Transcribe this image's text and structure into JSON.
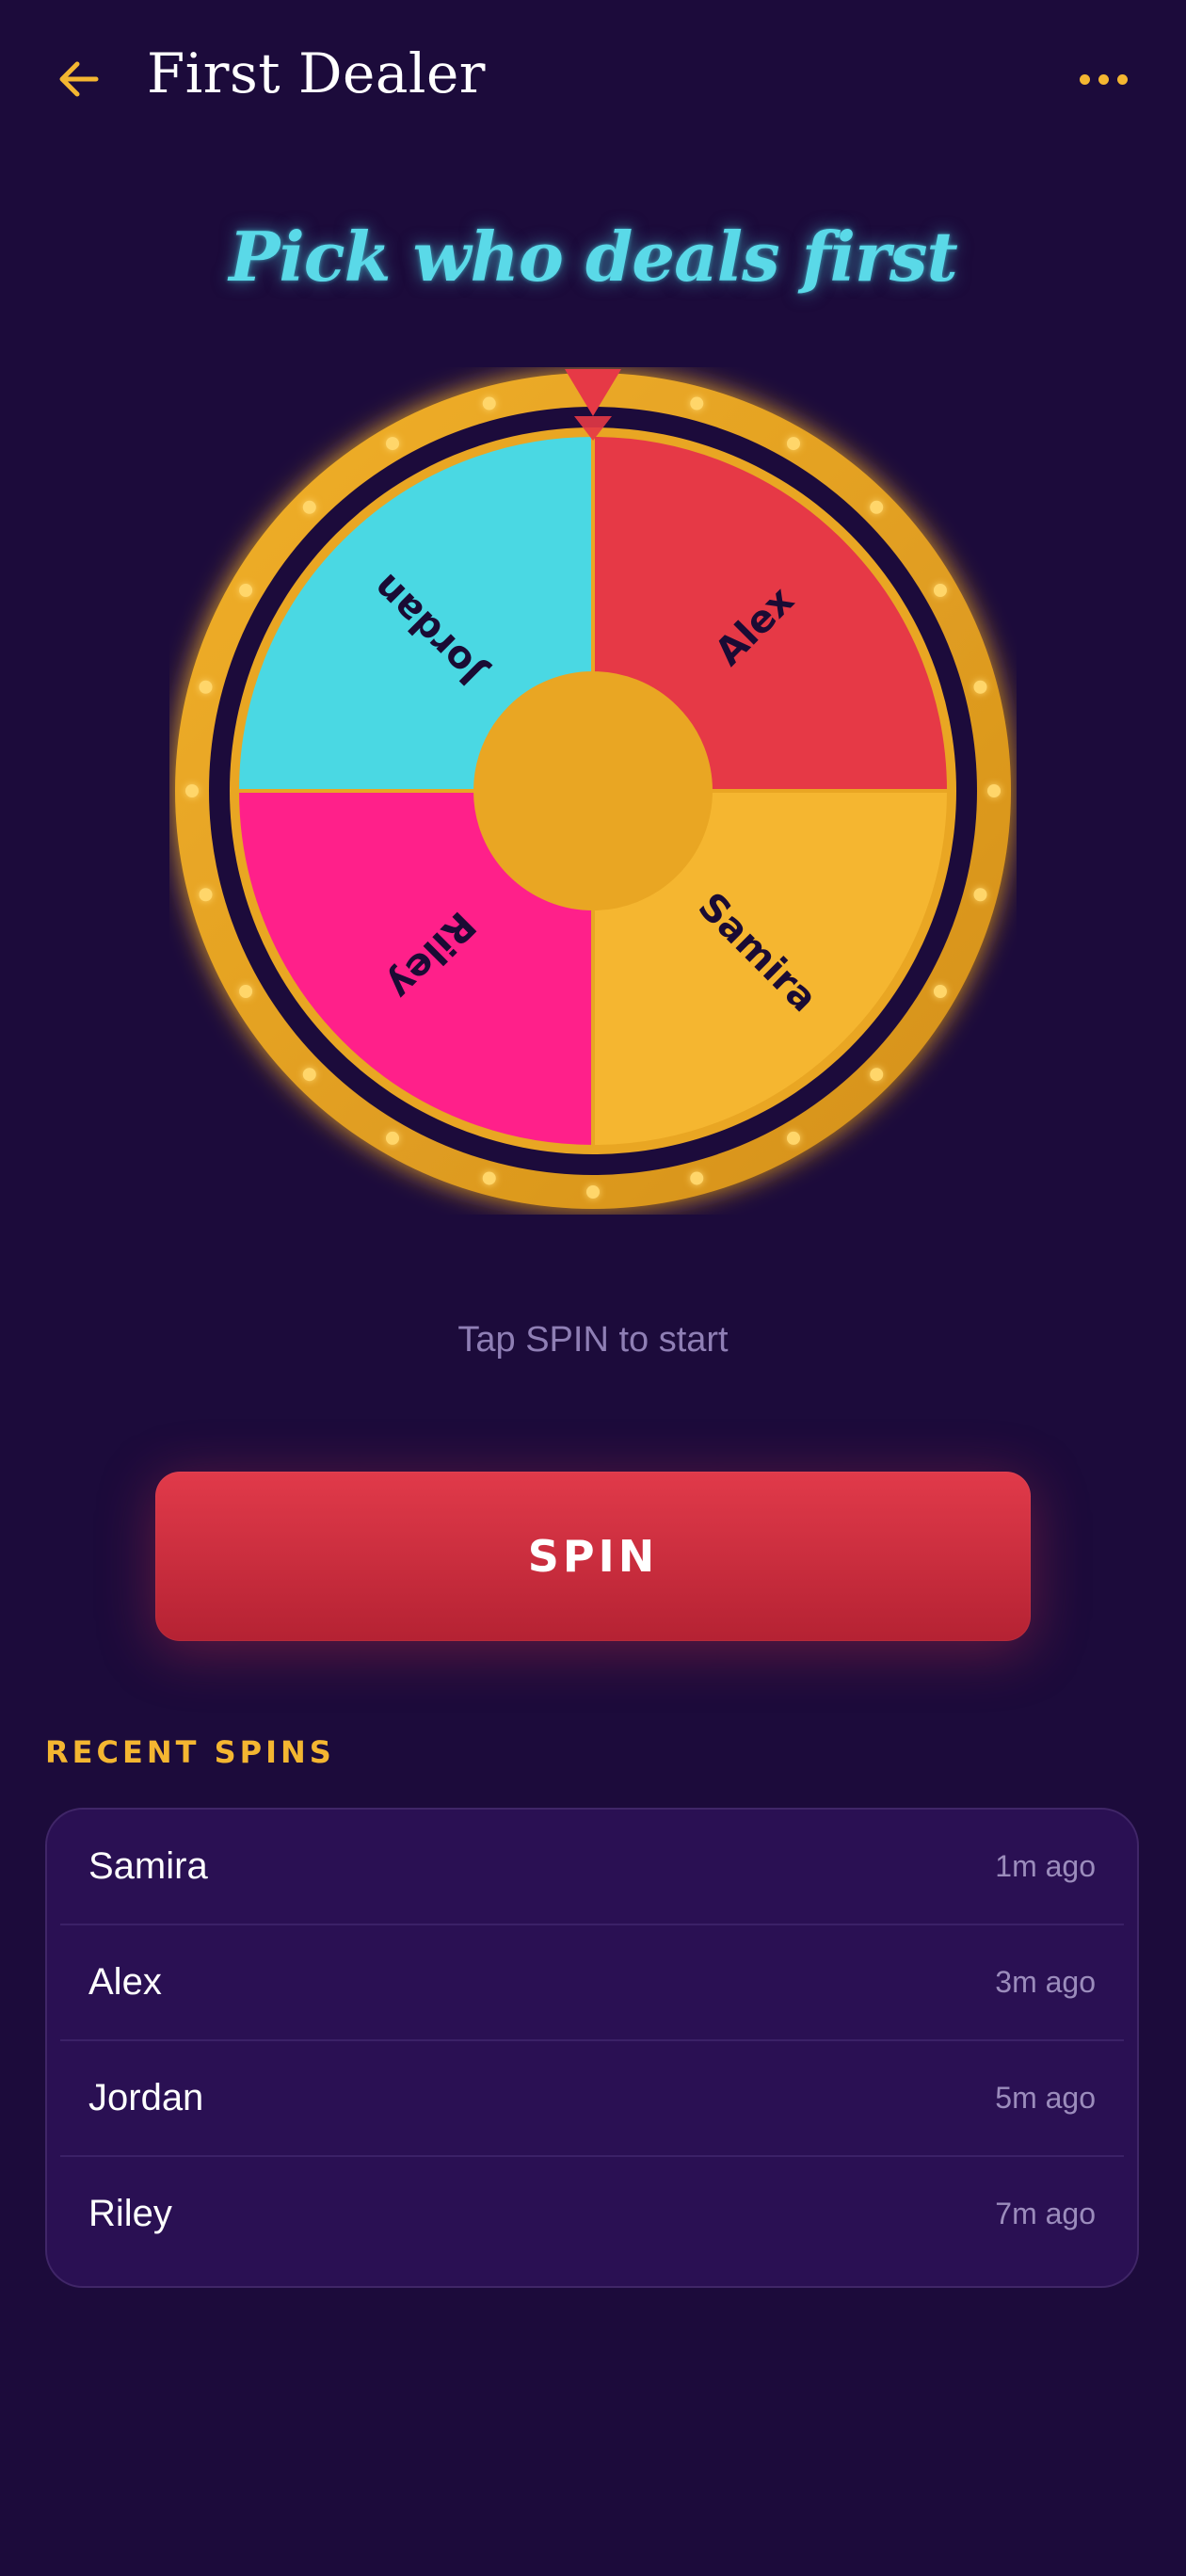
{
  "header": {
    "title": "First Dealer"
  },
  "headline": "Pick who deals first",
  "wheel": {
    "segments": [
      {
        "name": "Alex",
        "color": "#e63946"
      },
      {
        "name": "Samira",
        "color": "#f5b630"
      },
      {
        "name": "Riley",
        "color": "#ff208a"
      },
      {
        "name": "Jordan",
        "color": "#4ad8e3"
      }
    ],
    "rim_color": "#e9a623",
    "pointer_color": "#e63946"
  },
  "hint": "Tap SPIN to start",
  "spin_label": "SPIN",
  "recent": {
    "label": "RECENT SPINS",
    "items": [
      {
        "name": "Samira",
        "time": "1m ago"
      },
      {
        "name": "Alex",
        "time": "3m ago"
      },
      {
        "name": "Jordan",
        "time": "5m ago"
      },
      {
        "name": "Riley",
        "time": "7m ago"
      }
    ]
  },
  "colors": {
    "accent": "#f4b631",
    "background": "#1c0b3b",
    "card": "#2a1053"
  }
}
